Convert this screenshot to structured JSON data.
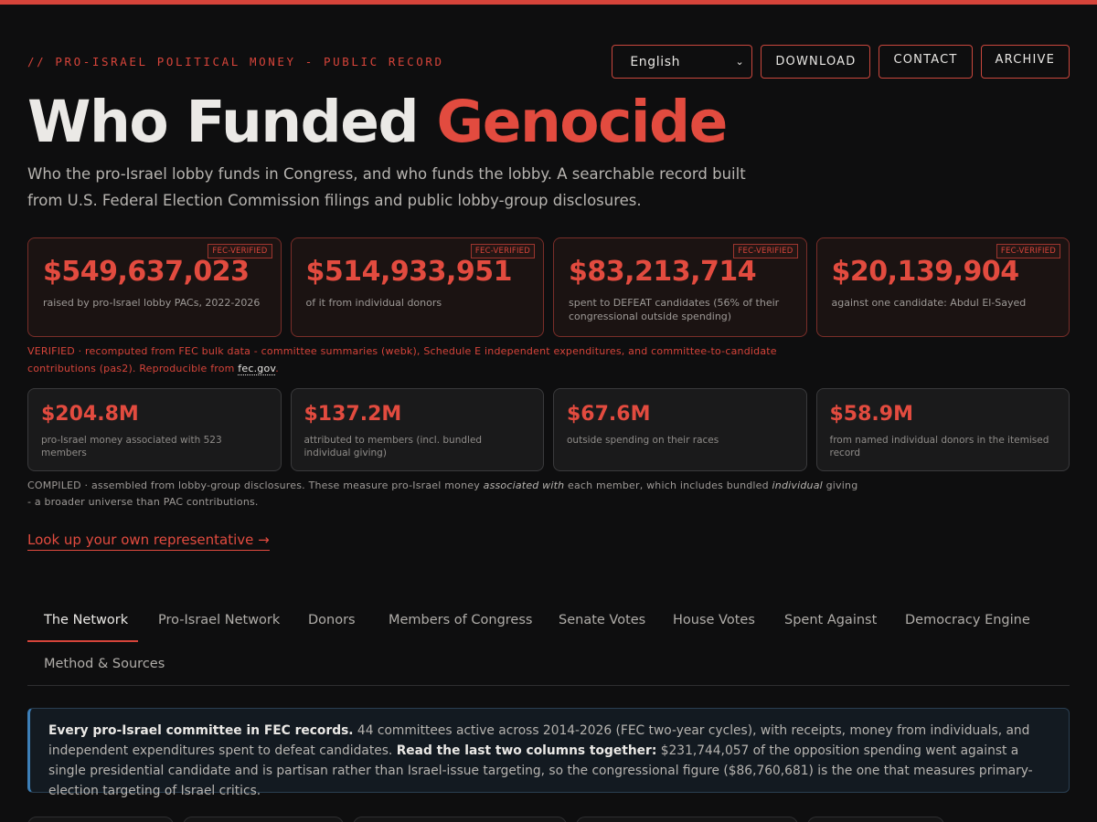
{
  "header": {
    "kicker": "// PRO-ISRAEL POLITICAL MONEY - PUBLIC RECORD",
    "language": "English",
    "download": "DOWNLOAD",
    "contact": "CONTACT",
    "archive": "ARCHIVE",
    "title_main": "Who Funded ",
    "title_accent": "Genocide",
    "subtitle": "Who the pro-Israel lobby funds in Congress, and who funds the lobby. A searchable record built from U.S. Federal Election Commission filings and public lobby-group disclosures."
  },
  "verified_cards": [
    {
      "badge": "FEC-VERIFIED",
      "value": "$549,637,023",
      "label": "raised by pro-Israel lobby PACs, 2022-2026"
    },
    {
      "badge": "FEC-VERIFIED",
      "value": "$514,933,951",
      "label": "of it from individual donors"
    },
    {
      "badge": "FEC-VERIFIED",
      "value": "$83,213,714",
      "label": "spent to DEFEAT candidates (56% of their congressional outside spending)"
    },
    {
      "badge": "FEC-VERIFIED",
      "value": "$20,139,904",
      "label": "against one candidate: Abdul El-Sayed"
    }
  ],
  "verified_note": {
    "text": "VERIFIED · recomputed from FEC bulk data - committee summaries (webk), Schedule E independent expenditures, and committee-to-candidate contributions (pas2). Reproducible from ",
    "link": "fec.gov",
    "end": "."
  },
  "compiled_cards": [
    {
      "value": "$204.8M",
      "label": "pro-Israel money associated with 523 members"
    },
    {
      "value": "$137.2M",
      "label": "attributed to members (incl. bundled individual giving)"
    },
    {
      "value": "$67.6M",
      "label": "outside spending on their races"
    },
    {
      "value": "$58.9M",
      "label": "from named individual donors in the itemised record"
    }
  ],
  "compiled_note": {
    "part1": "COMPILED · assembled from lobby-group disclosures. These measure pro-Israel money ",
    "em1": "associated with",
    "part2": " each member, which includes bundled ",
    "em2": "individual",
    "part3": " giving - a broader universe than PAC contributions."
  },
  "lookup_link": "Look up your own representative →",
  "tabs": [
    "The Network",
    "Pro-Israel Network",
    "Donors",
    "Members of Congress",
    "Senate Votes",
    "House Votes",
    "Spent Against",
    "Democracy Engine",
    "Method & Sources"
  ],
  "info": {
    "bold1": "Every pro-Israel committee in FEC records.",
    "text1": " 44 committees active across 2014-2026 (FEC two-year cycles), with receipts, money from individuals, and independent expenditures spent to defeat candidates. ",
    "bold2": "Read the last two columns together:",
    "text2": " $231,744,057 of the opposition spending went against a single presidential candidate and is partisan rather than Israel-issue targeting, so the congressional figure ($86,760,681) is the one that measures primary-election targeting of Israel critics."
  }
}
